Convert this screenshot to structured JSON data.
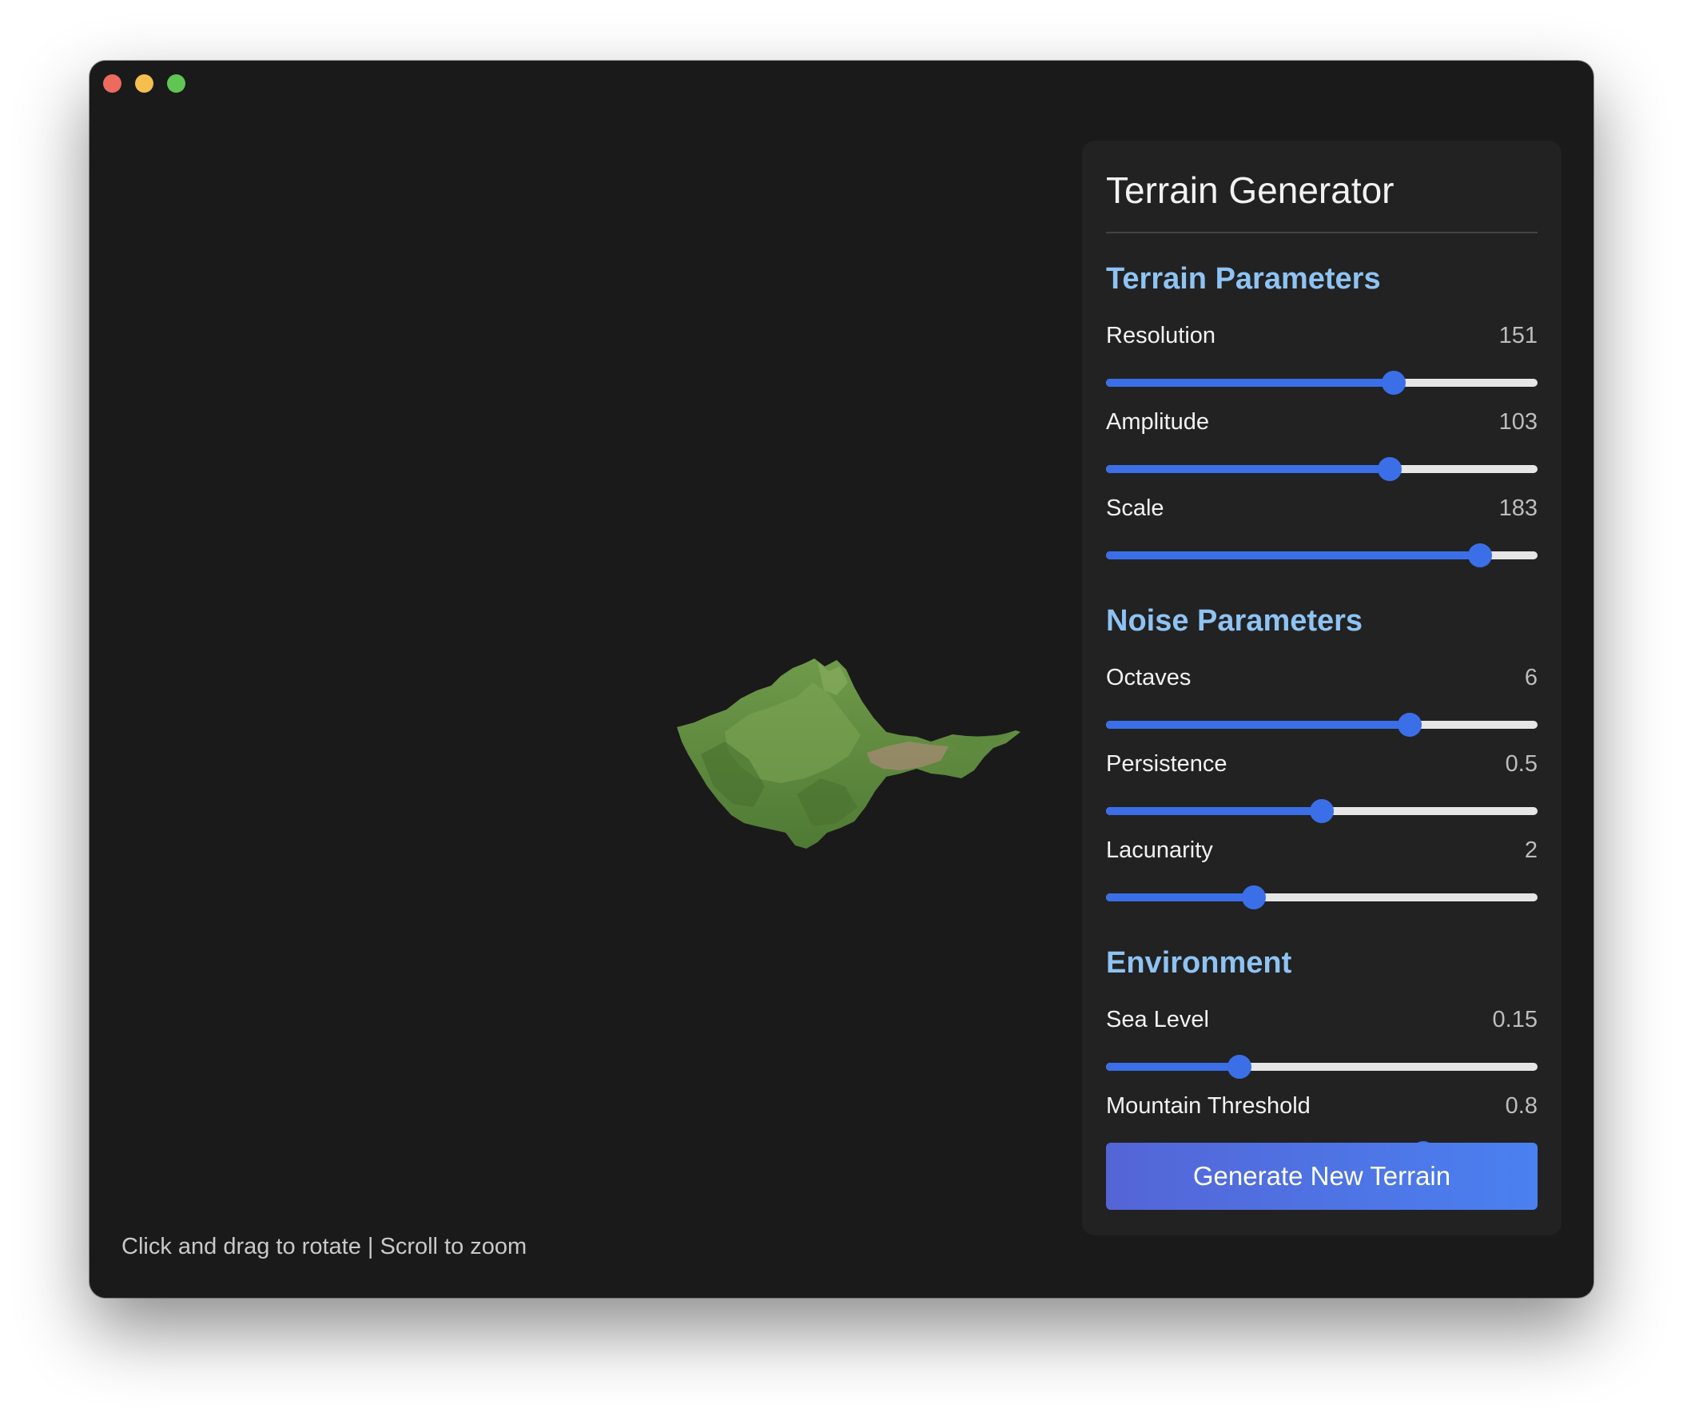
{
  "hint": "Click and drag to rotate | Scroll to zoom",
  "panel": {
    "title": "Terrain Generator",
    "sections": {
      "terrain": {
        "title": "Terrain Parameters",
        "params": [
          {
            "label": "Resolution",
            "value": "151",
            "fraction": 0.666
          },
          {
            "label": "Amplitude",
            "value": "103",
            "fraction": 0.657
          },
          {
            "label": "Scale",
            "value": "183",
            "fraction": 0.867
          }
        ]
      },
      "noise": {
        "title": "Noise Parameters",
        "params": [
          {
            "label": "Octaves",
            "value": "6",
            "fraction": 0.704
          },
          {
            "label": "Persistence",
            "value": "0.5",
            "fraction": 0.5
          },
          {
            "label": "Lacunarity",
            "value": "2",
            "fraction": 0.343
          }
        ]
      },
      "environment": {
        "title": "Environment",
        "params": [
          {
            "label": "Sea Level",
            "value": "0.15",
            "fraction": 0.31
          },
          {
            "label": "Mountain Threshold",
            "value": "0.8",
            "fraction": 0.735
          }
        ]
      }
    },
    "generate_label": "Generate New Terrain"
  },
  "colors": {
    "accent": "#3b6fe8",
    "section_title": "#8ec3f3",
    "background": "#1a1a1a",
    "panel": "#222222",
    "terrain_green": "#5e8a3e",
    "terrain_sand": "#9a8a6a"
  }
}
